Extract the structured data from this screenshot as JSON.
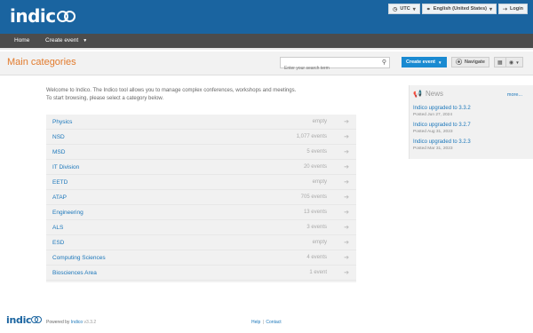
{
  "header": {
    "logo_text": "indico",
    "timezone_label": "UTC",
    "language_label": "English (United States)",
    "login_label": "Login"
  },
  "menu": {
    "items": [
      {
        "label": "Home"
      },
      {
        "label": "Create event"
      }
    ]
  },
  "title_bar": {
    "title": "Main categories",
    "search_placeholder": "Enter your search term",
    "create_event_label": "Create event",
    "navigate_label": "Navigate"
  },
  "intro": {
    "line1": "Welcome to Indico. The Indico tool allows you to manage complex conferences, workshops and meetings.",
    "line2": "To start browsing, please select a category below."
  },
  "categories": [
    {
      "name": "Physics",
      "count": "empty"
    },
    {
      "name": "NSD",
      "count": "1,077 events"
    },
    {
      "name": "MSD",
      "count": "5 events"
    },
    {
      "name": "IT Division",
      "count": "20 events"
    },
    {
      "name": "EETD",
      "count": "empty"
    },
    {
      "name": "ATAP",
      "count": "705 events"
    },
    {
      "name": "Engineering",
      "count": "13 events"
    },
    {
      "name": "ALS",
      "count": "3 events"
    },
    {
      "name": "ESD",
      "count": "empty"
    },
    {
      "name": "Computing Sciences",
      "count": "4 events"
    },
    {
      "name": "Biosciences Area",
      "count": "1 event"
    }
  ],
  "news": {
    "title": "News",
    "more_label": "more...",
    "items": [
      {
        "title": "Indico upgraded to 3.3.2",
        "date": "Posted Jun 27, 2024"
      },
      {
        "title": "Indico upgraded to 3.2.7",
        "date": "Posted Aug 31, 2023"
      },
      {
        "title": "Indico upgraded to 3.2.3",
        "date": "Posted Mar 31, 2023"
      }
    ]
  },
  "footer": {
    "logo_text": "indico",
    "powered_by": "Powered by",
    "product": "Indico",
    "version": "v3.3.2",
    "help_label": "Help",
    "separator": "|",
    "contact_label": "Contact"
  },
  "colors": {
    "header_bg": "#1a64a0",
    "menu_bg": "#4c4c4c",
    "title_accent": "#e27b2d",
    "link": "#1a76ba",
    "primary_button": "#1a8ad1"
  },
  "icons": {
    "timezone": "clock-icon",
    "language": "globe-icon",
    "login": "login-icon",
    "search": "search-icon",
    "navigate": "compass-icon",
    "calendar": "calendar-icon",
    "view": "eye-icon",
    "news": "megaphone-icon",
    "category_arrow": "arrow-right-icon"
  }
}
